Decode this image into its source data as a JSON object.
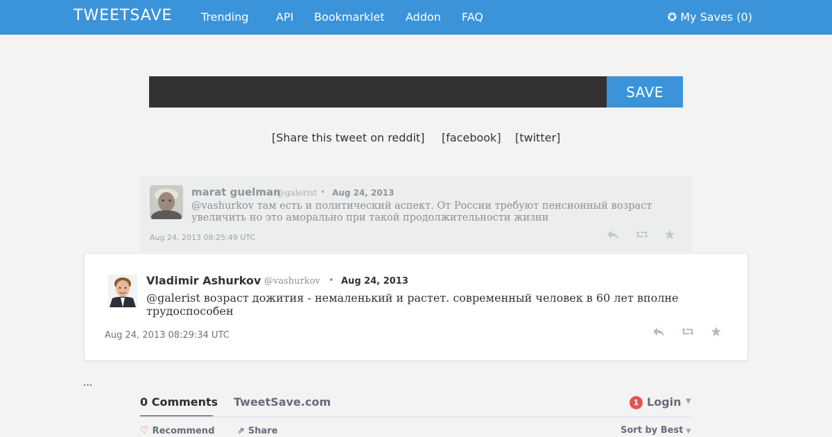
{
  "header": {
    "logo": "TWEETSAVE",
    "nav": [
      "Trending",
      "API",
      "Bookmarklet",
      "Addon",
      "FAQ"
    ],
    "my_saves": "My Saves (0)",
    "my_saves_icon": "gear-star-icon"
  },
  "search": {
    "value": "",
    "button_label": "SAVE"
  },
  "share_links": {
    "reddit": "[Share this tweet on reddit]",
    "facebook": "[facebook]",
    "twitter": "[twitter]"
  },
  "parent_tweet": {
    "name": "marat guelman",
    "handle": "@galerist",
    "dot": "•",
    "date": "Aug 24, 2013",
    "text": "@vashurkov там есть и политический аспект. От России требуют пенсионный возраст увеличить но это аморально при такой продолжительности жизни",
    "timestamp": "Aug 24, 2013 08:25:49 UTC"
  },
  "main_tweet": {
    "name": "Vladimir Ashurkov",
    "handle": "@vashurkov",
    "dot": "•",
    "date": "Aug 24, 2013",
    "text": "@galerist возраст дожития - немаленький и растет. современный человек в 60 лет вполне трудоспособен",
    "timestamp": "Aug 24, 2013 08:29:34 UTC"
  },
  "ellipsis": "...",
  "comments": {
    "tab_active": "0 Comments",
    "tab_site": "TweetSave.com",
    "login_badge": "1",
    "login": "Login",
    "recommend": "Recommend",
    "share": "Share",
    "sort": "Sort by Best"
  },
  "colors": {
    "brand": "#3b94d9",
    "badge": "#e5544c"
  }
}
